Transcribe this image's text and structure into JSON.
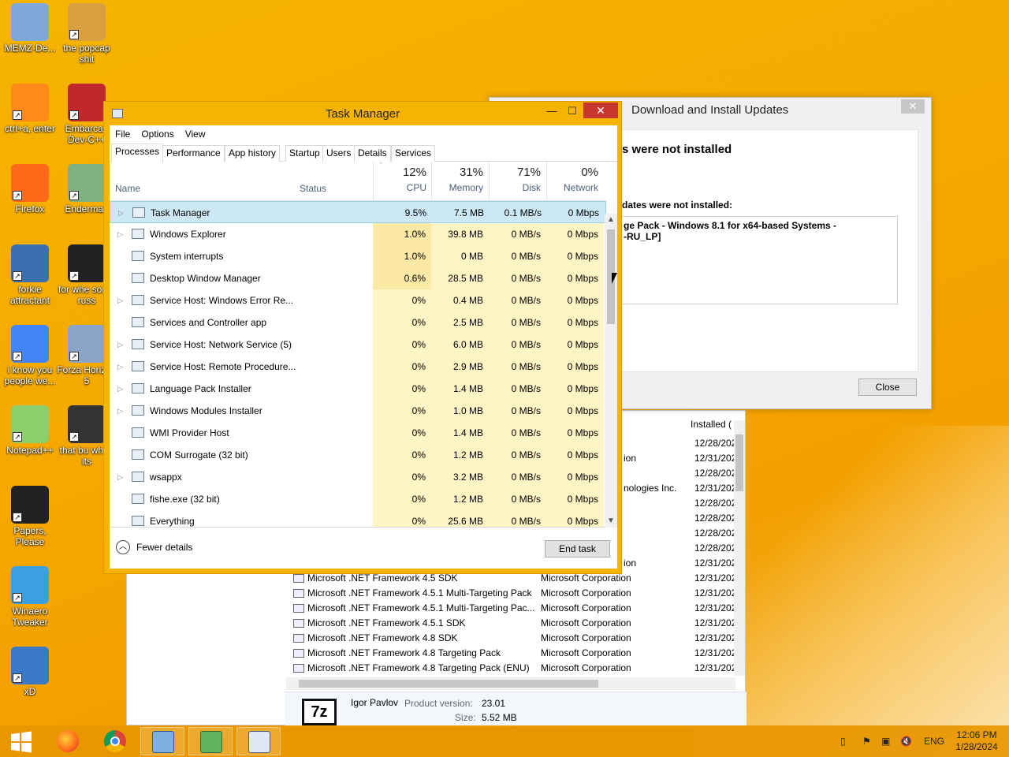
{
  "desktop": {
    "icons": [
      {
        "label": "MEMZ-De..."
      },
      {
        "label": "the popcap shit"
      },
      {
        "label": "ctrl+a, enter"
      },
      {
        "label": "Embarcad Dev-C++"
      },
      {
        "label": "Firefox"
      },
      {
        "label": "Enderman"
      },
      {
        "label": "forkie attractant"
      },
      {
        "label": "for whe some russ"
      },
      {
        "label": "i know you people we..."
      },
      {
        "label": "Forza Horizon 5"
      },
      {
        "label": "Notepad++"
      },
      {
        "label": "that bu when its"
      },
      {
        "label": "Papers, Please"
      },
      {
        "label": "Winaero Tweaker"
      },
      {
        "label": "xD"
      }
    ]
  },
  "task_manager": {
    "title": "Task Manager",
    "menu": [
      "File",
      "Options",
      "View"
    ],
    "tabs": [
      "Processes",
      "Performance",
      "App history",
      "Startup",
      "Users",
      "Details",
      "Services"
    ],
    "headers": {
      "name": "Name",
      "status": "Status",
      "cpu_pct": "12%",
      "cpu": "CPU",
      "mem_pct": "31%",
      "mem": "Memory",
      "disk_pct": "71%",
      "disk": "Disk",
      "net_pct": "0%",
      "net": "Network"
    },
    "processes": [
      {
        "name": "Task Manager",
        "cpu": "9.5%",
        "mem": "7.5 MB",
        "disk": "0.1 MB/s",
        "net": "0 Mbps",
        "exp": true
      },
      {
        "name": "Windows Explorer",
        "cpu": "1.0%",
        "mem": "39.8 MB",
        "disk": "0 MB/s",
        "net": "0 Mbps",
        "exp": true
      },
      {
        "name": "System interrupts",
        "cpu": "1.0%",
        "mem": "0 MB",
        "disk": "0 MB/s",
        "net": "0 Mbps",
        "exp": false
      },
      {
        "name": "Desktop Window Manager",
        "cpu": "0.6%",
        "mem": "28.5 MB",
        "disk": "0 MB/s",
        "net": "0 Mbps",
        "exp": false
      },
      {
        "name": "Service Host: Windows Error Re...",
        "cpu": "0%",
        "mem": "0.4 MB",
        "disk": "0 MB/s",
        "net": "0 Mbps",
        "exp": true
      },
      {
        "name": "Services and Controller app",
        "cpu": "0%",
        "mem": "2.5 MB",
        "disk": "0 MB/s",
        "net": "0 Mbps",
        "exp": false
      },
      {
        "name": "Service Host: Network Service (5)",
        "cpu": "0%",
        "mem": "6.0 MB",
        "disk": "0 MB/s",
        "net": "0 Mbps",
        "exp": true
      },
      {
        "name": "Service Host: Remote Procedure...",
        "cpu": "0%",
        "mem": "2.9 MB",
        "disk": "0 MB/s",
        "net": "0 Mbps",
        "exp": true
      },
      {
        "name": "Language Pack Installer",
        "cpu": "0%",
        "mem": "1.4 MB",
        "disk": "0 MB/s",
        "net": "0 Mbps",
        "exp": true
      },
      {
        "name": "Windows Modules Installer",
        "cpu": "0%",
        "mem": "1.0 MB",
        "disk": "0 MB/s",
        "net": "0 Mbps",
        "exp": true
      },
      {
        "name": "WMI Provider Host",
        "cpu": "0%",
        "mem": "1.4 MB",
        "disk": "0 MB/s",
        "net": "0 Mbps",
        "exp": false
      },
      {
        "name": "COM Surrogate (32 bit)",
        "cpu": "0%",
        "mem": "1.2 MB",
        "disk": "0 MB/s",
        "net": "0 Mbps",
        "exp": false
      },
      {
        "name": "wsappx",
        "cpu": "0%",
        "mem": "3.2 MB",
        "disk": "0 MB/s",
        "net": "0 Mbps",
        "exp": true
      },
      {
        "name": "fishe.exe (32 bit)",
        "cpu": "0%",
        "mem": "1.2 MB",
        "disk": "0 MB/s",
        "net": "0 Mbps",
        "exp": false
      },
      {
        "name": "Everything",
        "cpu": "0%",
        "mem": "25.6 MB",
        "disk": "0 MB/s",
        "net": "0 Mbps",
        "exp": false
      }
    ],
    "fewer_details": "Fewer details",
    "end_task": "End task"
  },
  "updates": {
    "title": "Download and Install Updates",
    "heading": "s were not installed",
    "subheading": "dates were not installed:",
    "box_text": "ge Pack - Windows 8.1 for x64-based Systems -\n-RU_LP]",
    "close": "Close"
  },
  "programs": {
    "installed_header": "Installed (",
    "partial_rows": [
      {
        "publisher": "",
        "date": "12/28/202"
      },
      {
        "publisher": "ion",
        "date": "12/31/202"
      },
      {
        "publisher": "",
        "date": "12/28/202"
      },
      {
        "publisher": "nologies Inc.",
        "date": "12/31/202"
      },
      {
        "publisher": "",
        "date": "12/28/202"
      },
      {
        "publisher": "",
        "date": "12/28/202"
      },
      {
        "publisher": "",
        "date": "12/28/202"
      },
      {
        "publisher": "",
        "date": "12/28/202"
      },
      {
        "publisher": "ion",
        "date": "12/31/202"
      }
    ],
    "rows": [
      {
        "name": "Microsoft .NET Framework 4.5 SDK",
        "publisher": "Microsoft Corporation",
        "date": "12/31/202"
      },
      {
        "name": "Microsoft .NET Framework 4.5.1 Multi-Targeting Pack",
        "publisher": "Microsoft Corporation",
        "date": "12/31/202"
      },
      {
        "name": "Microsoft .NET Framework 4.5.1 Multi-Targeting Pac...",
        "publisher": "Microsoft Corporation",
        "date": "12/31/202"
      },
      {
        "name": "Microsoft .NET Framework 4.5.1 SDK",
        "publisher": "Microsoft Corporation",
        "date": "12/31/202"
      },
      {
        "name": "Microsoft .NET Framework 4.8 SDK",
        "publisher": "Microsoft Corporation",
        "date": "12/31/202"
      },
      {
        "name": "Microsoft .NET Framework 4.8 Targeting Pack",
        "publisher": "Microsoft Corporation",
        "date": "12/31/202"
      },
      {
        "name": "Microsoft .NET Framework 4.8 Targeting Pack (ENU)",
        "publisher": "Microsoft Corporation",
        "date": "12/31/202"
      }
    ],
    "detail": {
      "logo": "7z",
      "publisher": "Igor Pavlov",
      "version_label": "Product version:",
      "version": "23.01",
      "size_label": "Size:",
      "size": "5.52 MB"
    }
  },
  "taskbar": {
    "lang": "ENG",
    "time": "12:06 PM",
    "date": "1/28/2024"
  }
}
